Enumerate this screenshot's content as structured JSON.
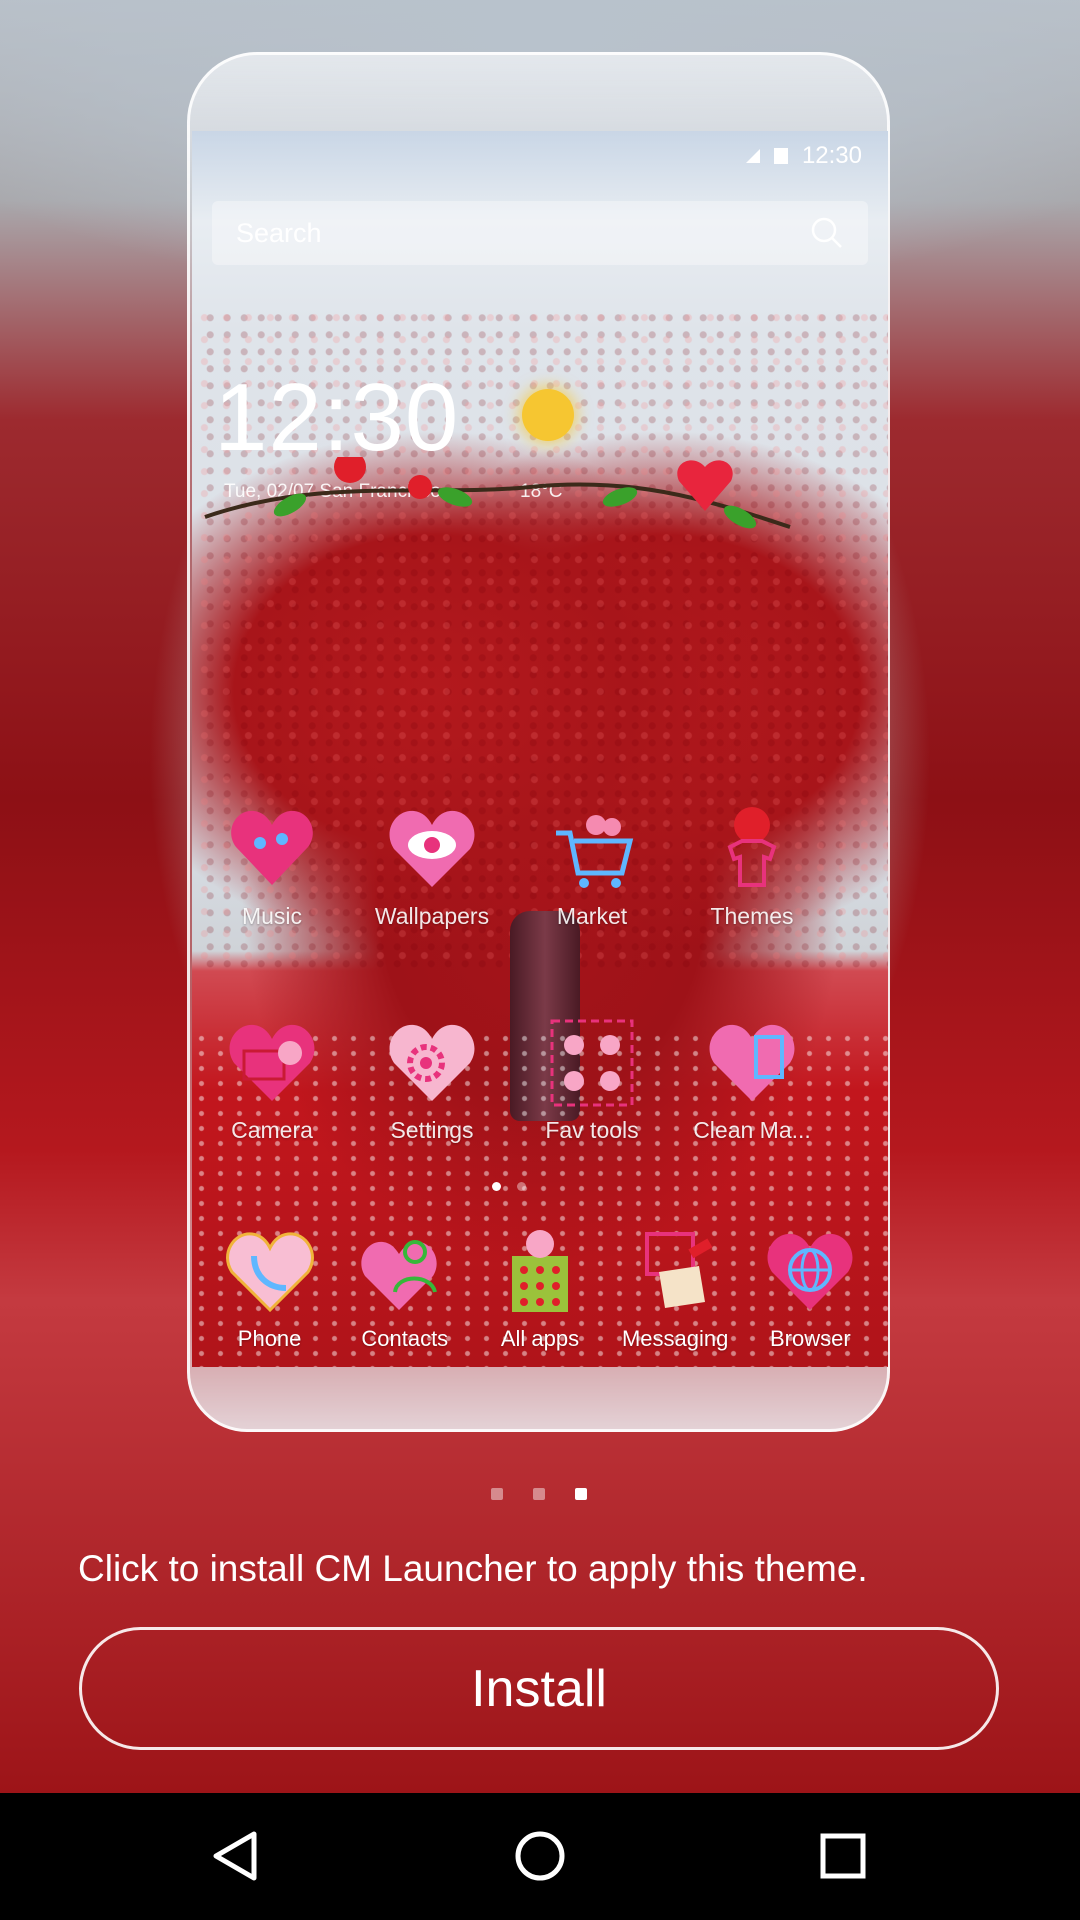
{
  "status_bar": {
    "time": "12:30"
  },
  "search": {
    "placeholder": "Search"
  },
  "clock_widget": {
    "time": "12:30",
    "date_location": "Tue, 02/07  San Francisco",
    "temperature": "18°C"
  },
  "apps_row1": [
    {
      "label": "Music",
      "icon": "music-icon"
    },
    {
      "label": "Wallpapers",
      "icon": "wallpapers-icon"
    },
    {
      "label": "Market",
      "icon": "market-icon"
    },
    {
      "label": "Themes",
      "icon": "themes-icon"
    }
  ],
  "apps_row2": [
    {
      "label": "Camera",
      "icon": "camera-icon"
    },
    {
      "label": "Settings",
      "icon": "settings-icon"
    },
    {
      "label": "Fav tools",
      "icon": "fav-tools-icon"
    },
    {
      "label": "Clean Ma...",
      "icon": "clean-master-icon"
    }
  ],
  "dock": [
    {
      "label": "Phone",
      "icon": "phone-icon"
    },
    {
      "label": "Contacts",
      "icon": "contacts-icon"
    },
    {
      "label": "All apps",
      "icon": "all-apps-icon"
    },
    {
      "label": "Messaging",
      "icon": "messaging-icon"
    },
    {
      "label": "Browser",
      "icon": "browser-icon"
    }
  ],
  "preview_pager": {
    "total": 3,
    "active": 3
  },
  "install": {
    "message": "Click to install CM Launcher to apply this theme.",
    "button_label": "Install"
  },
  "navigation": [
    "back-icon",
    "home-icon",
    "recents-icon"
  ],
  "colors": {
    "accent_red": "#b3191d",
    "heart_pink": "#e8327c",
    "sun": "#f6c631"
  }
}
